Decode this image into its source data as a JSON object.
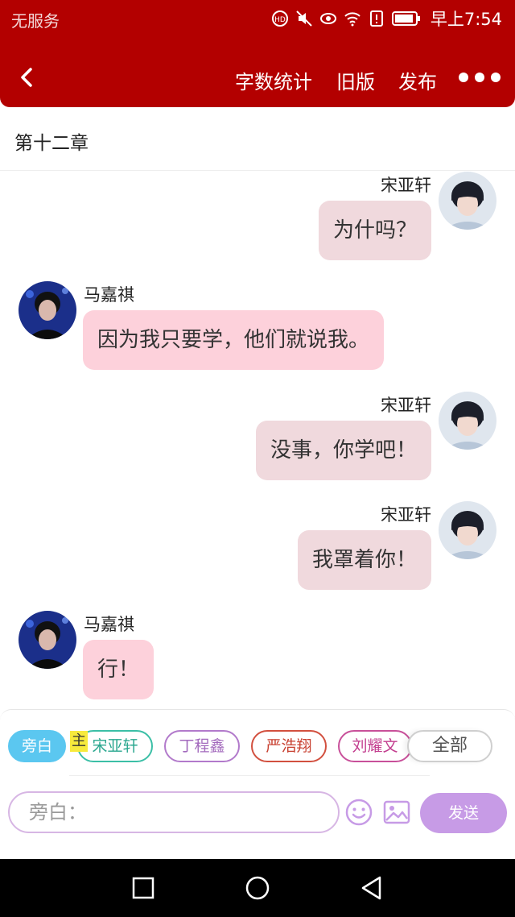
{
  "status": {
    "carrier": "无服务",
    "time": "早上7:54"
  },
  "nav": {
    "stats_label": "字数统计",
    "old_label": "旧版",
    "publish_label": "发布"
  },
  "chapter": "第十二章",
  "messages": [
    {
      "sender": "宋亚轩",
      "side": "right",
      "text": "为什吗？"
    },
    {
      "sender": "马嘉祺",
      "side": "left",
      "text": "因为我只要学，他们就说我。"
    },
    {
      "sender": "宋亚轩",
      "side": "right",
      "text": "没事，你学吧！"
    },
    {
      "sender": "宋亚轩",
      "side": "right",
      "text": "我罩着你！"
    },
    {
      "sender": "马嘉祺",
      "side": "left",
      "text": "行！"
    }
  ],
  "roles": {
    "narration": "旁白",
    "host_mark": "主",
    "list": [
      "宋亚轩",
      "丁程鑫",
      "严浩翔",
      "刘耀文"
    ],
    "all": "全部"
  },
  "composer": {
    "placeholder": "旁白：",
    "send": "发送"
  },
  "colors": {
    "brand_red": "#b30000",
    "bubble_right": "#f0d9dd",
    "bubble_left": "#fdd1db",
    "send_button": "#c79be6",
    "narration_chip": "#5bc7f0"
  }
}
